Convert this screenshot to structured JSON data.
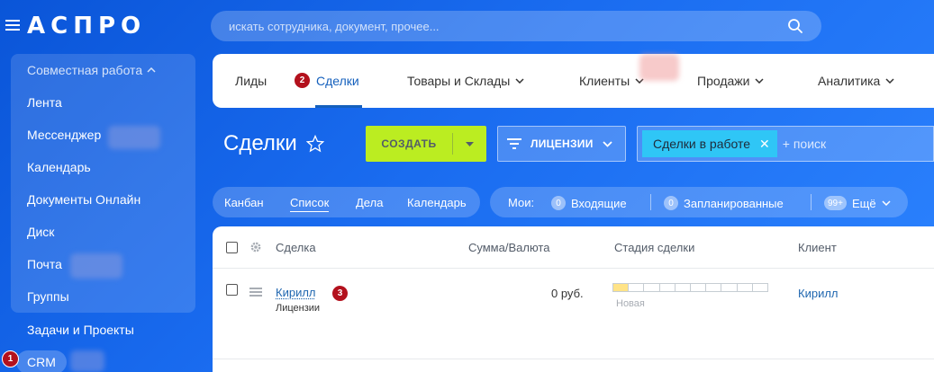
{
  "header": {
    "logo": "АСПРО",
    "search_placeholder": "искать сотрудника, документ, прочее..."
  },
  "sidebar": {
    "group_title": "Совместная работа",
    "items": [
      {
        "label": "Лента"
      },
      {
        "label": "Мессенджер"
      },
      {
        "label": "Календарь"
      },
      {
        "label": "Документы Онлайн"
      },
      {
        "label": "Диск"
      },
      {
        "label": "Почта"
      },
      {
        "label": "Группы"
      }
    ],
    "tasks": "Задачи и Проекты",
    "crm": "CRM"
  },
  "badges": [
    "1",
    "2",
    "3"
  ],
  "tabs": [
    {
      "label": "Лиды"
    },
    {
      "label": "Сделки",
      "active": true
    },
    {
      "label": "Товары и Склады"
    },
    {
      "label": "Клиенты"
    },
    {
      "label": "Продажи"
    },
    {
      "label": "Аналитика"
    }
  ],
  "page": {
    "title": "Сделки",
    "create_button": "СОЗДАТЬ",
    "category_button": "ЛИЦЕНЗИИ",
    "filter_tag": "Сделки в работе",
    "filter_placeholder": "+ поиск"
  },
  "views": [
    "Канбан",
    "Список",
    "Дела",
    "Календарь"
  ],
  "counters": {
    "my_label": "Мои:",
    "incoming": {
      "count": "0",
      "label": "Входящие"
    },
    "planned": {
      "count": "0",
      "label": "Запланированные"
    },
    "more": {
      "count": "99+",
      "label": "Ещё"
    }
  },
  "grid": {
    "columns": [
      "Сделка",
      "Сумма/Валюта",
      "Стадия сделки",
      "Клиент"
    ],
    "rows": [
      {
        "deal": "Кирилл",
        "category": "Лицензии",
        "amount": "0 руб.",
        "stage": "Новая",
        "stage_progress": 0.1,
        "client": "Кирилл"
      }
    ]
  },
  "colors": {
    "create_button": "#bbed21",
    "filter_tag": "#2fc6f6",
    "link": "#2067b0",
    "badge": "#b3111d"
  }
}
